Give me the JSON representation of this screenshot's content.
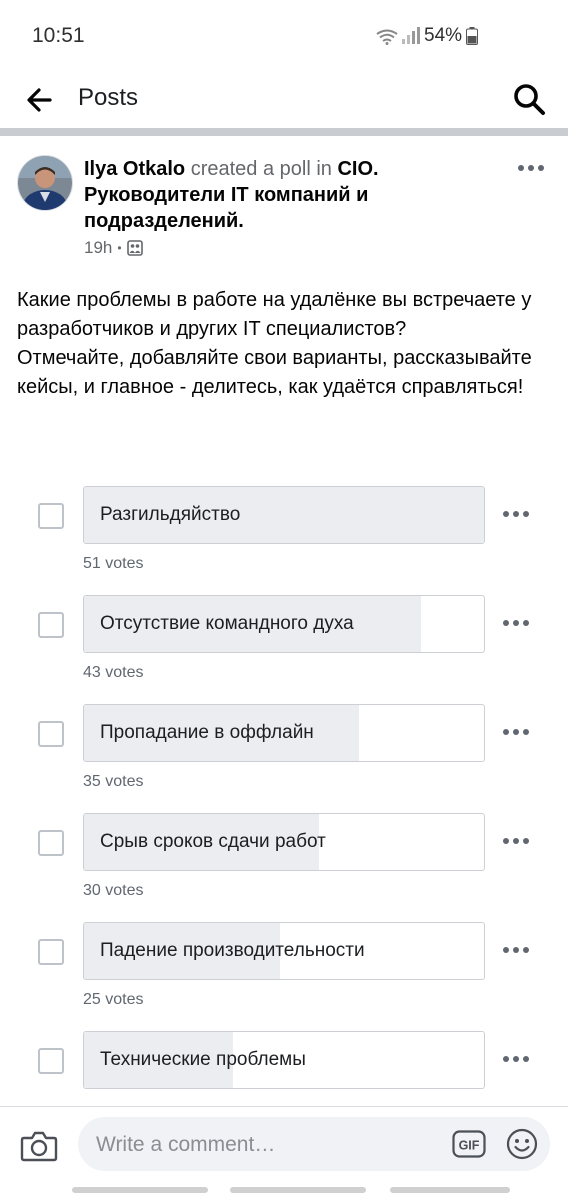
{
  "status_bar": {
    "time": "10:51",
    "battery": "54%"
  },
  "header": {
    "title": "Posts"
  },
  "post": {
    "author": "Ilya  Otkalo",
    "action": " created a poll in ",
    "group": "CIO. Руководители IT компаний и подразделений.",
    "time": "19h",
    "separator": "•",
    "text_lines": [
      "Какие проблемы в работе на удалёнке вы встречаете у разработчиков и других IT специалистов?",
      "Отмечайте, добавляйте свои варианты, рассказывайте кейсы, и главное - делитесь, как удаётся справляться!"
    ]
  },
  "poll": {
    "options": [
      {
        "label": "Разгильдяйство",
        "votes": "51 votes",
        "vote_count": 51
      },
      {
        "label": "Отсутствие командного духа",
        "votes": "43 votes",
        "vote_count": 43
      },
      {
        "label": "Пропадание в оффлайн",
        "votes": "35 votes",
        "vote_count": 35
      },
      {
        "label": "Срыв сроков сдачи работ",
        "votes": "30 votes",
        "vote_count": 30
      },
      {
        "label": "Падение производительности",
        "votes": "25 votes",
        "vote_count": 25
      },
      {
        "label": "Технические проблемы",
        "votes": "",
        "vote_count": 19
      }
    ],
    "max_votes": 51
  },
  "comment_bar": {
    "placeholder": "Write a comment…",
    "gif_label": "GIF"
  },
  "colors": {
    "fill": "#ebedf0",
    "divider": "#c9ccd1",
    "muted": "#65676b"
  }
}
